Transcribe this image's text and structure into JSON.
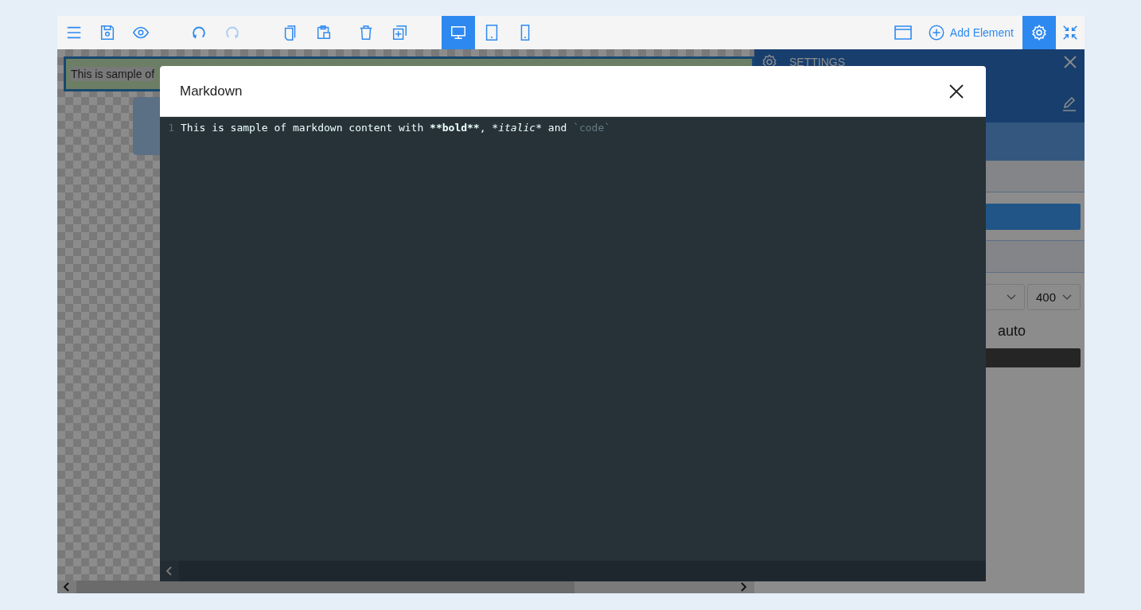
{
  "toolbar": {
    "tool_groups": [
      [
        {
          "kind": "menu",
          "disabled": false
        },
        {
          "kind": "save",
          "disabled": false
        },
        {
          "kind": "preview",
          "disabled": false
        }
      ],
      [
        {
          "kind": "undo",
          "disabled": false
        },
        {
          "kind": "redo",
          "disabled": true
        }
      ],
      [
        {
          "kind": "copy",
          "disabled": false
        },
        {
          "kind": "paste",
          "disabled": false
        }
      ],
      [
        {
          "kind": "delete",
          "disabled": false
        },
        {
          "kind": "duplicate",
          "disabled": false
        }
      ]
    ],
    "devices": [
      {
        "kind": "desktop",
        "selected": true
      },
      {
        "kind": "tablet",
        "selected": false
      },
      {
        "kind": "phone",
        "selected": false
      }
    ],
    "layout_tool": {
      "kind": "layout"
    },
    "add_element": {
      "label": "Add Element"
    },
    "panel_tools": [
      {
        "kind": "settings",
        "selected": true
      },
      {
        "kind": "collapse",
        "selected": false
      }
    ]
  },
  "canvas": {
    "element_text": "This is sample of"
  },
  "settings_panel": {
    "title": "SETTINGS",
    "font_weight": "400",
    "value": "auto"
  },
  "modal": {
    "title": "Markdown",
    "editor": {
      "lines": [
        {
          "number": "1",
          "segments": [
            {
              "kind": "text",
              "text": "This is sample of markdown content with "
            },
            {
              "kind": "strong",
              "text": "**bold**"
            },
            {
              "kind": "text",
              "text": ", "
            },
            {
              "kind": "em",
              "text": "*italic*"
            },
            {
              "kind": "text",
              "text": " and "
            },
            {
              "kind": "code",
              "text": "`code`"
            }
          ]
        }
      ]
    }
  }
}
